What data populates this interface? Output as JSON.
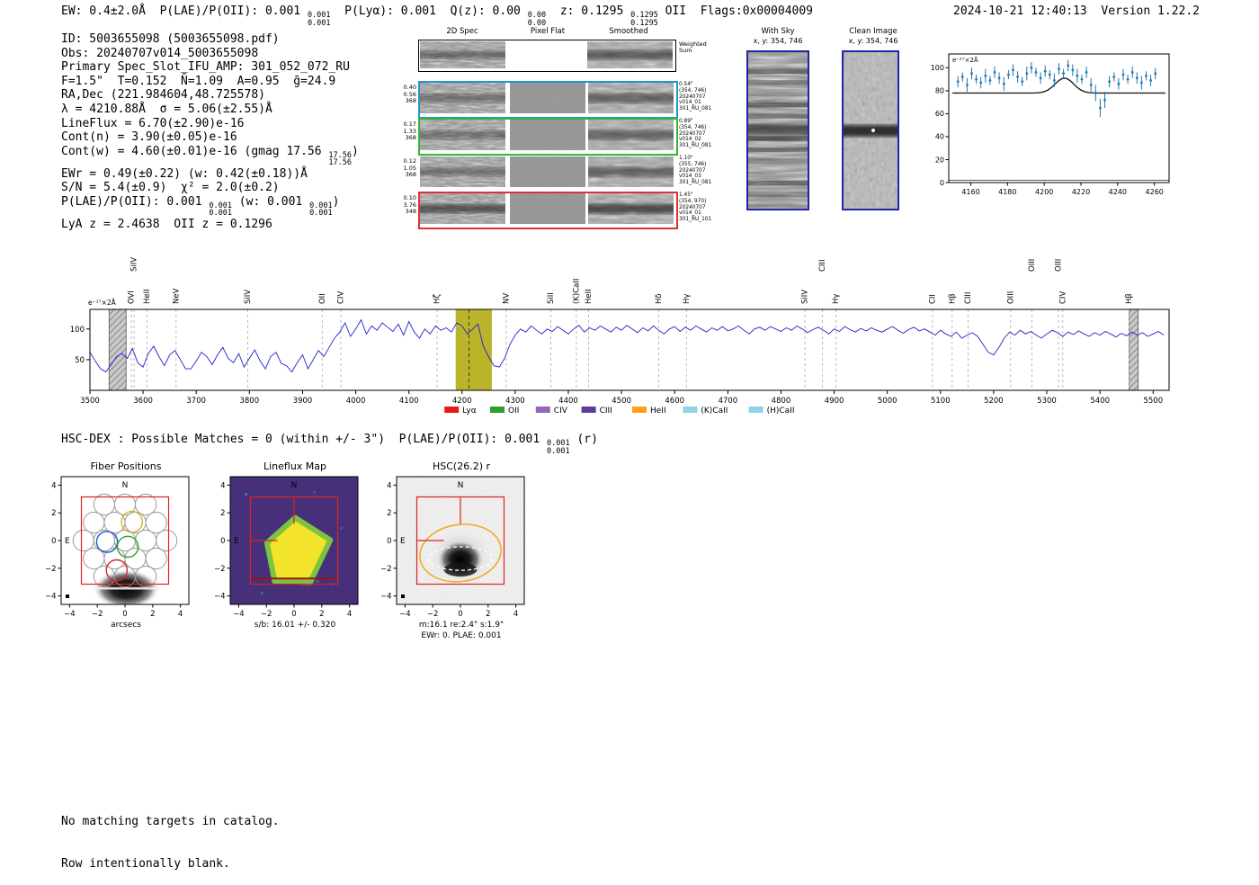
{
  "header": {
    "segments": [
      {
        "t": "EW: 0.4±2.0Å  P(LAE)/P(OII): 0.001 "
      },
      {
        "frac": [
          "0.001",
          "0.001"
        ]
      },
      {
        "t": "  P(Lyα): 0.001  Q(z): 0.00 "
      },
      {
        "frac": [
          "0.00",
          "0.00"
        ]
      },
      {
        "t": "  z: 0.1295 "
      },
      {
        "frac": [
          "0.1295",
          "0.1295"
        ]
      },
      {
        "t": " OII  Flags:0x00004009"
      }
    ],
    "timestamp": "2024-10-21 12:40:13",
    "version": "Version 1.22.2"
  },
  "info": {
    "lines": [
      [
        {
          "t": "ID: 5003655098 (5003655098.pdf)"
        }
      ],
      [
        {
          "t": "Obs: 20240707v014_5003655098"
        }
      ],
      [
        {
          "t": "Primary Spec_Slot_IFU_AMP: 301_052_072_RU"
        }
      ],
      [
        {
          "t": "F=1.5\"  T=0.152  N̄=1.09  A=0.95  ḡ=24.9"
        }
      ],
      [
        {
          "t": "RA,Dec (221.984604,48.725578)"
        }
      ],
      [
        {
          "t": "λ = 4210.88Å  σ = 5.06(±2.55)Å"
        }
      ],
      [
        {
          "t": "LineFlux = 6.70(±2.90)e-16"
        }
      ],
      [
        {
          "t": "Cont(n) = 3.90(±0.05)e-16"
        }
      ],
      [
        {
          "t": "Cont(w) = 4.60(±0.01)e-16 (gmag 17.56 "
        },
        {
          "frac": [
            "17.56",
            "17.56"
          ]
        },
        {
          "t": ")"
        }
      ],
      [
        {
          "t": "EWr = 0.49(±0.22) (w: 0.42(±0.18))Å"
        }
      ],
      [
        {
          "t": "S/N = 5.4(±0.9)  χ² = 2.0(±0.2)"
        }
      ],
      [
        {
          "t": "P(LAE)/P(OII): 0.001 "
        },
        {
          "frac": [
            "0.001",
            "0.001"
          ]
        },
        {
          "t": " (w: 0.001 "
        },
        {
          "frac": [
            "0.001",
            "0.001"
          ]
        },
        {
          "t": ")"
        }
      ],
      [
        {
          "t": "LyA z = 2.4638  OII z = 0.1296"
        }
      ]
    ]
  },
  "cutouts": {
    "col_headers": [
      "2D Spec",
      "Pixel Flat",
      "Smoothed"
    ],
    "weighted_label": [
      "Weighted",
      "Sum"
    ],
    "rows": [
      {
        "left": [
          "0.40",
          "0.56",
          "368"
        ],
        "right": [
          "0.54\"",
          "(354, 746)",
          "20240707",
          "v014_01",
          "301_RU_081"
        ],
        "border": "#2196c8"
      },
      {
        "left": [
          "0.17",
          "1.33",
          "368"
        ],
        "right": [
          "0.89\"",
          "(354, 746)",
          "20240707",
          "v014_02",
          "301_RU_081"
        ],
        "border": "#35b535"
      },
      {
        "left": [
          "0.12",
          "1.05",
          "368"
        ],
        "right": [
          "1.10\"",
          "(355, 746)",
          "20240707",
          "v014_03",
          "301_RU_081"
        ],
        "border": null
      },
      {
        "left": [
          "0.10",
          "3.76",
          "348"
        ],
        "right": [
          "1.45\"",
          "(354, 970)",
          "20240707",
          "v014_01",
          "301_RU_101"
        ],
        "border": "#e03030"
      }
    ]
  },
  "sky_panels": {
    "with_sky": {
      "title": "With Sky",
      "coords": "x, y: 354, 746"
    },
    "clean": {
      "title": "Clean Image",
      "coords": "x, y: 354, 746"
    }
  },
  "hscdex": {
    "segments": [
      {
        "t": "HSC-DEX : Possible Matches = 0 (within +/- 3\")  P(LAE)/P(OII): 0.001 "
      },
      {
        "frac": [
          "0.001",
          "0.001"
        ]
      },
      {
        "t": " (r)"
      }
    ]
  },
  "panels": {
    "fiber": {
      "title": "Fiber Positions",
      "xlabel": "arcsecs",
      "n_label": "N",
      "e_label": "E",
      "xticks": [
        -4,
        -2,
        0,
        2,
        4
      ],
      "yticks": [
        -4,
        -2,
        0,
        2,
        4
      ]
    },
    "lineflux": {
      "title": "Lineflux Map",
      "caption": "s/b: 16.01 +/- 0.320",
      "n_label": "N",
      "e_label": "E",
      "xticks": [
        -4,
        -2,
        0,
        2,
        4
      ],
      "yticks": [
        -4,
        -2,
        0,
        2,
        4
      ]
    },
    "hsc": {
      "title": "HSC(26.2) r",
      "caption1": "m:16.1  re:2.4\"  s:1.9\"",
      "caption2": "EWr: 0. PLAE: 0.001",
      "n_label": "N",
      "e_label": "E",
      "xticks": [
        -4,
        -2,
        0,
        2,
        4
      ],
      "yticks": [
        -4,
        -2,
        0,
        2,
        4
      ]
    }
  },
  "footer": {
    "lines": [
      "No matching targets in catalog.",
      "Row intentionally blank."
    ]
  },
  "chart_data": [
    {
      "type": "scatter",
      "title": "Line fit zoom",
      "ylabel": "e⁻¹⁷×2Å",
      "xlim": [
        4148,
        4268
      ],
      "ylim": [
        0,
        112
      ],
      "xticks": [
        4160,
        4180,
        4200,
        4220,
        4240,
        4260
      ],
      "yticks": [
        0,
        20,
        40,
        60,
        80,
        100
      ],
      "point_color": "#1f77b4",
      "fit_color": "#222222",
      "zero_line": 2,
      "fit": {
        "base": 78,
        "amp": 13,
        "center": 4211,
        "sigma": 5
      },
      "x": [
        4153,
        4155.5,
        4158,
        4160.5,
        4163,
        4165.5,
        4168,
        4170.5,
        4173,
        4175.5,
        4178,
        4180.5,
        4183,
        4185.5,
        4188,
        4190.5,
        4193,
        4195.5,
        4198,
        4200.5,
        4203,
        4205.5,
        4208,
        4210.5,
        4213,
        4215.5,
        4218,
        4220.5,
        4223,
        4225.5,
        4228,
        4230.5,
        4233,
        4235.5,
        4238,
        4240.5,
        4243,
        4245.5,
        4248,
        4250.5,
        4253,
        4255.5,
        4258,
        4260.5
      ],
      "y": [
        88,
        92,
        85,
        95,
        90,
        87,
        93,
        89,
        96,
        91,
        86,
        94,
        98,
        92,
        88,
        95,
        100,
        96,
        91,
        97,
        94,
        89,
        99,
        95,
        102,
        98,
        93,
        90,
        96,
        85,
        78,
        65,
        72,
        88,
        92,
        86,
        94,
        90,
        96,
        91,
        87,
        93,
        89,
        95
      ],
      "yerr": [
        5,
        4,
        6,
        5,
        4,
        5,
        6,
        4,
        5,
        5,
        6,
        4,
        5,
        5,
        4,
        6,
        5,
        4,
        5,
        5,
        4,
        6,
        5,
        4,
        5,
        5,
        6,
        4,
        5,
        6,
        7,
        8,
        7,
        5,
        4,
        5,
        5,
        4,
        5,
        5,
        6,
        4,
        5,
        5
      ]
    },
    {
      "type": "line",
      "title": "Full spectrum",
      "ylabel": "e⁻¹⁷×2Å",
      "xlim": [
        3500,
        5530
      ],
      "ylim": [
        0,
        132
      ],
      "xticks": [
        3500,
        3600,
        3700,
        3800,
        3900,
        4000,
        4100,
        4200,
        4300,
        4400,
        4500,
        4600,
        4700,
        4800,
        4900,
        5000,
        5100,
        5200,
        5300,
        5400,
        5500
      ],
      "yticks": [
        50,
        100
      ],
      "line_color": "#2222cc",
      "x_start": 3500,
      "x_step": 10,
      "flux": [
        62,
        48,
        35,
        30,
        42,
        55,
        60,
        52,
        68,
        45,
        38,
        60,
        72,
        55,
        40,
        58,
        65,
        50,
        35,
        35,
        48,
        62,
        55,
        42,
        58,
        70,
        52,
        45,
        60,
        38,
        52,
        66,
        48,
        35,
        55,
        62,
        44,
        40,
        30,
        45,
        58,
        35,
        50,
        65,
        55,
        70,
        85,
        95,
        110,
        88,
        100,
        115,
        92,
        105,
        98,
        110,
        103,
        96,
        108,
        90,
        112,
        95,
        85,
        100,
        92,
        105,
        98,
        102,
        95,
        110,
        105,
        92,
        100,
        108,
        72,
        55,
        40,
        38,
        52,
        75,
        90,
        100,
        95,
        105,
        98,
        92,
        100,
        96,
        104,
        98,
        92,
        100,
        106,
        95,
        102,
        98,
        105,
        100,
        95,
        103,
        98,
        106,
        100,
        94,
        102,
        97,
        105,
        98,
        92,
        100,
        104,
        96,
        103,
        98,
        105,
        100,
        95,
        102,
        98,
        104,
        97,
        100,
        105,
        98,
        92,
        100,
        103,
        98,
        104,
        100,
        96,
        102,
        98,
        105,
        100,
        94,
        99,
        103,
        98,
        92,
        100,
        96,
        104,
        99,
        95,
        101,
        97,
        102,
        98,
        95,
        100,
        104,
        98,
        93,
        99,
        103,
        97,
        100,
        95,
        90,
        98,
        92,
        88,
        95,
        85,
        90,
        94,
        88,
        75,
        62,
        58,
        70,
        85,
        95,
        90,
        98,
        92,
        96,
        90,
        85,
        92,
        98,
        94,
        88,
        95,
        91,
        97,
        92,
        88,
        94,
        90,
        96,
        92,
        87,
        93,
        89,
        95,
        90,
        94,
        88,
        92,
        96,
        90
      ],
      "center_line": 4213,
      "bands": [
        {
          "x0": 4188,
          "x1": 4256,
          "color": "#b9b42a",
          "opacity": 1,
          "type": "solid"
        },
        {
          "x0": 3536,
          "x1": 3568,
          "type": "hatch"
        },
        {
          "x0": 5455,
          "x1": 5472,
          "type": "hatch"
        }
      ],
      "markers": [
        {
          "wl": 3583,
          "label": "SiIV",
          "color": "#e8881c",
          "tall": true
        },
        {
          "wl": 3578,
          "label": "OVI",
          "color": "#e8881c",
          "tall": false
        },
        {
          "wl": 3607,
          "label": "HeII",
          "color": "#d62728",
          "tall": false
        },
        {
          "wl": 3662,
          "label": "NeV",
          "color": "#17a2a8",
          "tall": false
        },
        {
          "wl": 3797,
          "label": "SiIV",
          "color": "#9467bd",
          "tall": false
        },
        {
          "wl": 3937,
          "label": "OII",
          "color": "#8a9bb0",
          "tall": false
        },
        {
          "wl": 3972,
          "label": "CIV",
          "color": "#e8881c",
          "tall": false
        },
        {
          "wl": 4153,
          "label": "Hζ",
          "color": "#5bc8e8",
          "tall": false
        },
        {
          "wl": 4283,
          "label": "NV",
          "color": "#d62728",
          "tall": false
        },
        {
          "wl": 4367,
          "label": "SiII",
          "color": "#d62728",
          "tall": false
        },
        {
          "wl": 4415,
          "label": "(K)CaII",
          "color": "#2ca02c",
          "tall": false
        },
        {
          "wl": 4438,
          "label": "HeII",
          "color": "#9467bd",
          "tall": false
        },
        {
          "wl": 4570,
          "label": "Hδ",
          "color": "#5bc8e8",
          "tall": false
        },
        {
          "wl": 4622,
          "label": "Hγ",
          "color": "#5bc8e8",
          "tall": false
        },
        {
          "wl": 4845,
          "label": "SiIV",
          "color": "#d62728",
          "tall": false
        },
        {
          "wl": 4878,
          "label": "CIII",
          "color": "#e8a01c",
          "tall": true
        },
        {
          "wl": 4903,
          "label": "Hγ",
          "color": "#17a2a8",
          "tall": false
        },
        {
          "wl": 5085,
          "label": "CII",
          "color": "#9467bd",
          "tall": false
        },
        {
          "wl": 5122,
          "label": "Hβ",
          "color": "#5bc8e8",
          "tall": false
        },
        {
          "wl": 5152,
          "label": "CIII",
          "color": "#d62728",
          "tall": false
        },
        {
          "wl": 5232,
          "label": "OIII",
          "color": "#9aa0a6",
          "tall": false
        },
        {
          "wl": 5272,
          "label": "OIII",
          "color": "#5bc8e8",
          "tall": true
        },
        {
          "wl": 5322,
          "label": "OIII",
          "color": "#5bc8e8",
          "tall": true
        },
        {
          "wl": 5330,
          "label": "CIV",
          "color": "#d62728",
          "tall": false
        },
        {
          "wl": 5455,
          "label": "Hβ",
          "color": "#2ca02c",
          "tall": false
        }
      ],
      "legend": [
        {
          "label": "Lyα",
          "color": "#e41a1c"
        },
        {
          "label": "OII",
          "color": "#2ca02c"
        },
        {
          "label": "CIV",
          "color": "#9467bd"
        },
        {
          "label": "CIII",
          "color": "#5e3c99"
        },
        {
          "label": "HeII",
          "color": "#ff9f1c"
        },
        {
          "label": "(K)CaII",
          "color": "#8fd3e8"
        },
        {
          "label": "(H)CaII",
          "color": "#8fd3e8"
        }
      ]
    }
  ]
}
